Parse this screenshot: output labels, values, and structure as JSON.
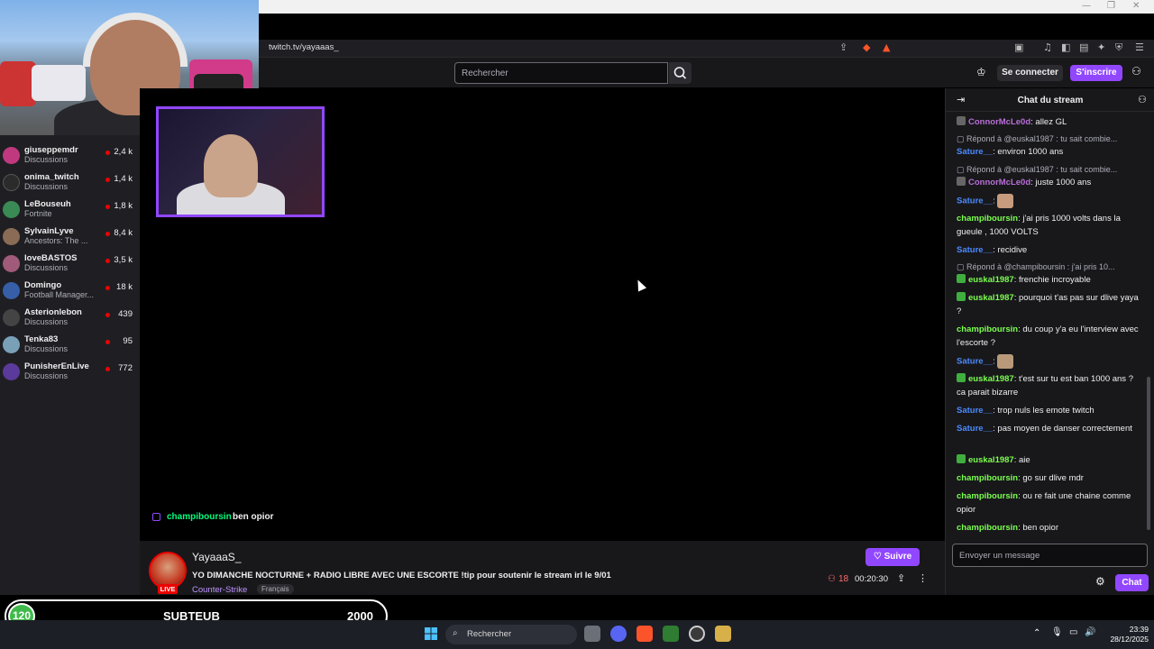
{
  "browser": {
    "url": "twitch.tv/yayaaas_"
  },
  "topnav": {
    "search_placeholder": "Rechercher",
    "login_label": "Se connecter",
    "signup_label": "S'inscrire"
  },
  "sidebar": {
    "channels": [
      {
        "name": "giuseppemdr",
        "game": "Discussions",
        "viewers": "2,4 k",
        "color": "#c0397f"
      },
      {
        "name": "onima_twitch",
        "game": "Discussions",
        "viewers": "1,4 k",
        "color": "#2b2b2b"
      },
      {
        "name": "LeBouseuh",
        "game": "Fortnite",
        "viewers": "1,8 k",
        "color": "#3a8a55"
      },
      {
        "name": "SylvainLyve",
        "game": "Ancestors: The ...",
        "viewers": "8,4 k",
        "color": "#8a6b55"
      },
      {
        "name": "loveBASTOS",
        "game": "Discussions",
        "viewers": "3,5 k",
        "color": "#a05a7a"
      },
      {
        "name": "Domingo",
        "game": "Football Manager...",
        "viewers": "18 k",
        "color": "#365fa8"
      },
      {
        "name": "Asterionlebon",
        "game": "Discussions",
        "viewers": "439",
        "color": "#444"
      },
      {
        "name": "Tenka83",
        "game": "Discussions",
        "viewers": "95",
        "color": "#7aa0b8"
      },
      {
        "name": "PunisherEnLive",
        "game": "Discussions",
        "viewers": "772",
        "color": "#5a3a9a"
      }
    ]
  },
  "video": {
    "overlay_chat_user": "champiboursin",
    "overlay_chat_msg": "ben opior"
  },
  "info": {
    "streamer": "YayaaaS_",
    "live": "LIVE",
    "title": "YO DIMANCHE NOCTURNE + RADIO LIBRE AVEC UNE ESCORTE !tip pour soutenir le stream irl le 9/01",
    "game": "Counter-Strike",
    "tag": "Français",
    "follow_label": "Suivre",
    "viewers": "18",
    "uptime": "00:20:30"
  },
  "chat": {
    "title": "Chat du stream",
    "input_placeholder": "Envoyer un message",
    "send_label": "Chat",
    "messages": [
      {
        "type": "msg",
        "user": "ConnorMcLe0d",
        "color": "#b86fd6",
        "text": "allez GL"
      },
      {
        "type": "reply",
        "text": "Répond à @euskal1987 : tu sait combie..."
      },
      {
        "type": "msg",
        "user": "Sature__",
        "color": "#4b8bff",
        "text": "environ 1000 ans"
      },
      {
        "type": "reply",
        "text": "Répond à @euskal1987 : tu sait combie..."
      },
      {
        "type": "msg",
        "user": "ConnorMcLe0d",
        "color": "#b86fd6",
        "text": "juste 1000 ans"
      },
      {
        "type": "msg",
        "user": "Sature__",
        "color": "#4b8bff",
        "text": ""
      },
      {
        "type": "msg",
        "user": "champiboursin",
        "color": "#7cff4f",
        "text": "j'ai pris 1000 volts dans la gueule , 1000 VOLTS"
      },
      {
        "type": "msg",
        "user": "Sature__",
        "color": "#4b8bff",
        "text": "recidive"
      },
      {
        "type": "reply",
        "text": "Répond à @champiboursin : j'ai pris 10..."
      },
      {
        "type": "msg",
        "user": "euskal1987",
        "color": "#7cff4f",
        "text": "frenchie incroyable"
      },
      {
        "type": "msg",
        "user": "euskal1987",
        "color": "#7cff4f",
        "text": "pourquoi t'as pas sur dlive yaya ?"
      },
      {
        "type": "msg",
        "user": "champiboursin",
        "color": "#7cff4f",
        "text": "du coup y'a eu l'interview avec l'escorte ?"
      },
      {
        "type": "msg",
        "user": "Sature__",
        "color": "#4b8bff",
        "text": ""
      },
      {
        "type": "msg",
        "user": "euskal1987",
        "color": "#7cff4f",
        "text": "t'est sur tu est ban 1000 ans ? ca parait bizarre"
      },
      {
        "type": "msg",
        "user": "Sature__",
        "color": "#4b8bff",
        "text": "trop nuls les emote twitch"
      },
      {
        "type": "msg",
        "user": "Sature__",
        "color": "#4b8bff",
        "text": "pas moyen de danser correctement"
      },
      {
        "type": "msg",
        "user": "euskal1987",
        "color": "#7cff4f",
        "text": "aie"
      },
      {
        "type": "msg",
        "user": "champiboursin",
        "color": "#7cff4f",
        "text": "go sur dlive mdr"
      },
      {
        "type": "msg",
        "user": "champiboursin",
        "color": "#7cff4f",
        "text": "ou re fait une chaine comme opior"
      },
      {
        "type": "msg",
        "user": "champiboursin",
        "color": "#7cff4f",
        "text": "ben opior"
      }
    ]
  },
  "overlay": {
    "goal_current": "120",
    "label": "SUBTEUB",
    "goal_target": "2000"
  },
  "taskbar": {
    "search_placeholder": "Rechercher",
    "time": "23:39",
    "date": "28/12/2025"
  }
}
